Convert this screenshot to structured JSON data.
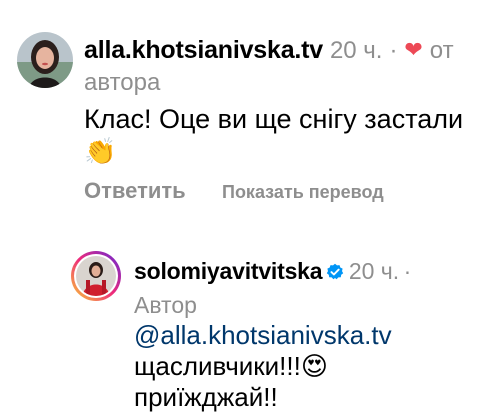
{
  "comment": {
    "username": "alla.khotsianivska.tv",
    "time": "20 ч.",
    "dot": "·",
    "heart_icon": "heart-icon",
    "heart_glyph": "❤",
    "by_author_1": "от",
    "by_author_2": "автора",
    "text": "Клас! Оце ви ще снігу застали",
    "emoji": "👏",
    "reply_label": "Ответить",
    "translate_label": "Показать перевод"
  },
  "reply": {
    "username": "solomiyavitvitska",
    "verified_icon": "verified-badge-icon",
    "time": "20 ч.",
    "dot": "·",
    "author_label": "Автор",
    "mention": "@alla.khotsianivska.tv",
    "text_line2": "щасливчики!!!",
    "emoji": "😍",
    "text_line3": "приїжджай!!"
  },
  "colors": {
    "heart": "#ed4956",
    "meta_gray": "#8e8e8e",
    "mention_blue": "#00376b",
    "verified_blue": "#0095f6"
  }
}
